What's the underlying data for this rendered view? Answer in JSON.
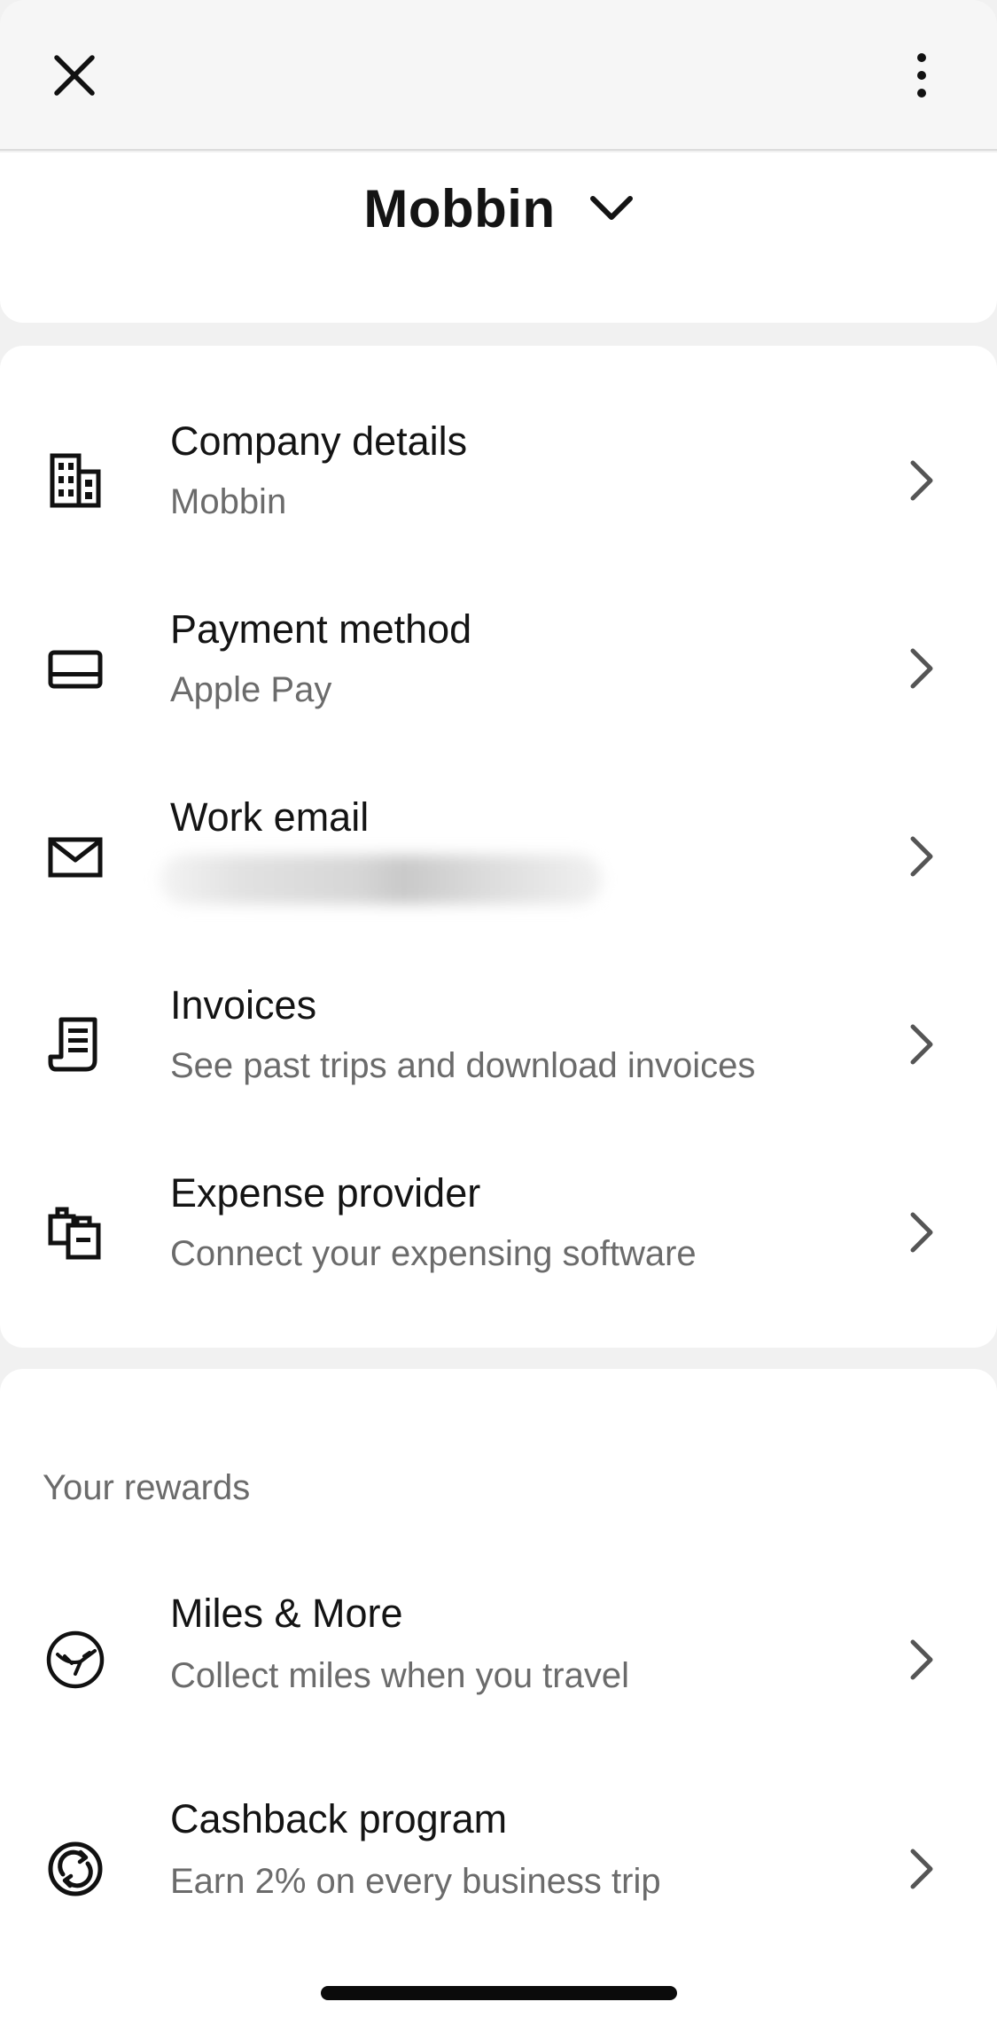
{
  "topbar": {
    "close_icon": "close-icon",
    "more_icon": "more-vertical-icon"
  },
  "account": {
    "name": "Mobbin",
    "dropdown_icon": "chevron-down-icon"
  },
  "settings": {
    "items": [
      {
        "icon": "building-icon",
        "title": "Company details",
        "subtitle": "Mobbin"
      },
      {
        "icon": "card-icon",
        "title": "Payment method",
        "subtitle": "Apple Pay"
      },
      {
        "icon": "mail-icon",
        "title": "Work email",
        "subtitle": ""
      },
      {
        "icon": "receipt-icon",
        "title": "Invoices",
        "subtitle": "See past trips and download invoices"
      },
      {
        "icon": "briefcase-icon",
        "title": "Expense provider",
        "subtitle": "Connect your expensing software"
      }
    ]
  },
  "rewards": {
    "section_label": "Your rewards",
    "items": [
      {
        "icon": "crane-logo-icon",
        "title": "Miles & More",
        "subtitle": "Collect miles when you travel"
      },
      {
        "icon": "cashback-icon",
        "title": "Cashback program",
        "subtitle": "Earn 2% on every business trip"
      }
    ]
  },
  "colors": {
    "background": "#f1f1f1",
    "card": "#ffffff",
    "text_primary": "#141414",
    "text_secondary": "#6b6b6b"
  }
}
